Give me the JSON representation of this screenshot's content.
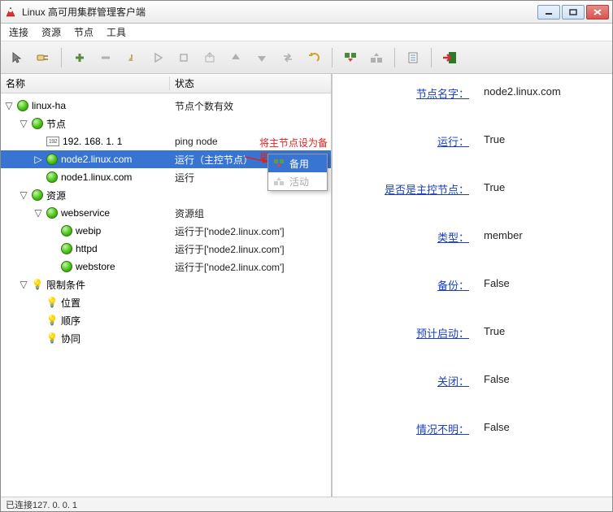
{
  "window": {
    "title": "Linux 高可用集群管理客户端"
  },
  "menu": {
    "connect": "连接",
    "resource": "资源",
    "node": "节点",
    "tool": "工具"
  },
  "tree": {
    "col_name": "名称",
    "col_status": "状态",
    "root": {
      "label": "linux-ha",
      "status": "节点个数有效"
    },
    "nodes_group": {
      "label": "节点"
    },
    "ip_node": {
      "label": "192. 168. 1. 1",
      "status": "ping node"
    },
    "node2": {
      "label": "node2.linux.com",
      "status": "运行（主控节点）"
    },
    "node1": {
      "label": "node1.linux.com",
      "status": "运行"
    },
    "res_group": {
      "label": "资源"
    },
    "webservice": {
      "label": "webservice",
      "status": "资源组"
    },
    "webip": {
      "label": "webip",
      "status": "运行于['node2.linux.com']"
    },
    "httpd": {
      "label": "httpd",
      "status": "运行于['node2.linux.com']"
    },
    "webstore": {
      "label": "webstore",
      "status": "运行于['node2.linux.com']"
    },
    "constraint_group": {
      "label": "限制条件"
    },
    "location": {
      "label": "位置"
    },
    "order": {
      "label": "顺序"
    },
    "coloc": {
      "label": "协同"
    }
  },
  "annot_text": "将主节点设为备用",
  "context_menu": {
    "standby": "备用",
    "active": "活动"
  },
  "props": {
    "name_label": "节点名字：",
    "name_val": "node2.linux.com",
    "run_label": "运行：",
    "run_val": "True",
    "master_label": "是否是主控节点：",
    "master_val": "True",
    "type_label": "类型：",
    "type_val": "member",
    "backup_label": "备份：",
    "backup_val": "False",
    "expect_label": "预计启动：",
    "expect_val": "True",
    "shutdown_label": "关闭：",
    "shutdown_val": "False",
    "unknown_label": "情况不明：",
    "unknown_val": "False"
  },
  "status_text": "已连接127. 0. 0. 1"
}
